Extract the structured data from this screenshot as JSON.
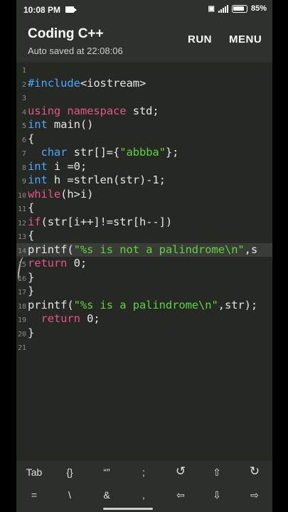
{
  "status": {
    "time": "10:08 PM",
    "battery": "85%",
    "icons": [
      "video-camera-icon",
      "data-saver-icon",
      "signal-icon",
      "battery-icon"
    ]
  },
  "appbar": {
    "title": "Coding C++",
    "subtitle": "Auto saved at 22:08:06",
    "run_label": "RUN",
    "menu_label": "MENU"
  },
  "editor": {
    "line_numbers": [
      "1",
      "2",
      "3",
      "4",
      "5",
      "6",
      "7",
      "8",
      "9",
      "10",
      "11",
      "12",
      "13",
      "14",
      "15",
      "16",
      "17",
      "18",
      "19",
      "20",
      "21"
    ],
    "highlighted_line": "14"
  },
  "keys": {
    "row1": [
      "Tab",
      "{}",
      "“”",
      ";",
      "↺",
      "⇧",
      "↻"
    ],
    "row2": [
      "=",
      "\\",
      "&",
      ",",
      "⇦",
      "⇩",
      "⇨"
    ]
  },
  "colors": {
    "keyword": "#e4548a",
    "type": "#49a8ff",
    "string": "#5fd33b",
    "background": "#262824"
  }
}
